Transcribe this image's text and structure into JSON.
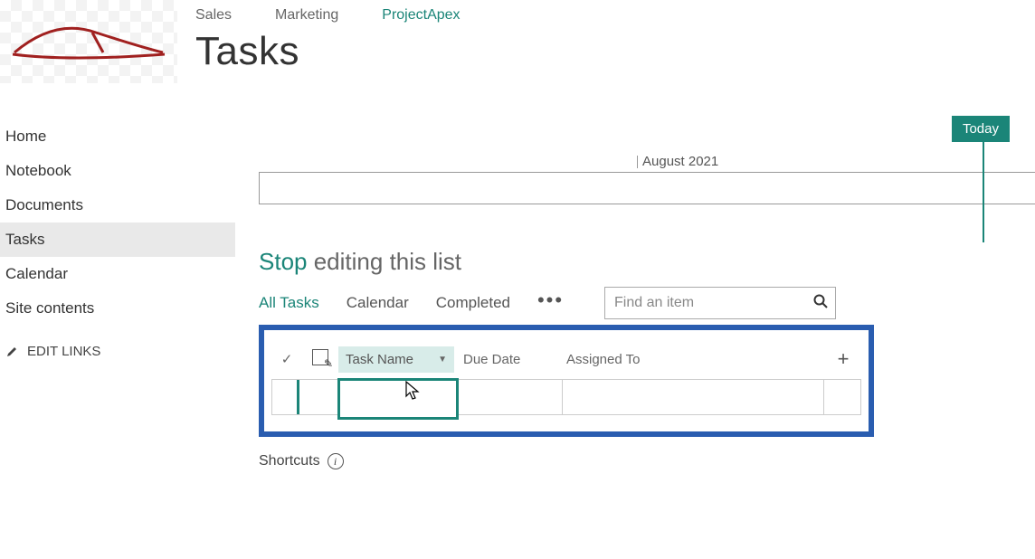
{
  "topNav": {
    "items": [
      {
        "label": "Sales",
        "active": false
      },
      {
        "label": "Marketing",
        "active": false
      },
      {
        "label": "ProjectApex",
        "active": true
      }
    ]
  },
  "pageTitle": "Tasks",
  "sidebar": {
    "items": [
      {
        "label": "Home",
        "selected": false
      },
      {
        "label": "Notebook",
        "selected": false
      },
      {
        "label": "Documents",
        "selected": false
      },
      {
        "label": "Tasks",
        "selected": true
      },
      {
        "label": "Calendar",
        "selected": false
      },
      {
        "label": "Site contents",
        "selected": false
      }
    ],
    "editLinks": "EDIT LINKS"
  },
  "timeline": {
    "todayLabel": "Today",
    "monthLabel": "August 2021"
  },
  "editHeader": {
    "stopLink": "Stop",
    "rest": " editing this list"
  },
  "viewTabs": {
    "items": [
      {
        "label": "All Tasks",
        "active": true
      },
      {
        "label": "Calendar",
        "active": false
      },
      {
        "label": "Completed",
        "active": false
      }
    ]
  },
  "search": {
    "placeholder": "Find an item"
  },
  "columns": {
    "taskName": "Task Name",
    "dueDate": "Due Date",
    "assignedTo": "Assigned To"
  },
  "shortcutsLabel": "Shortcuts"
}
